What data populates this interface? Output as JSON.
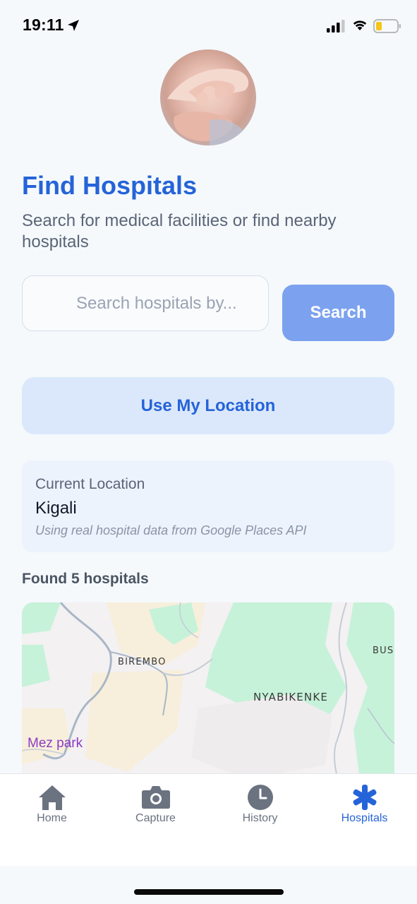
{
  "status_bar": {
    "time": "19:11",
    "icons": [
      "location-arrow-icon",
      "cellular-signal-icon",
      "wifi-icon",
      "battery-icon"
    ],
    "battery_color": "#f5c518"
  },
  "header": {
    "title": "Find Hospitals",
    "subtitle": "Search for medical facilities or find nearby hospitals"
  },
  "search": {
    "placeholder": "Search hospitals by...",
    "value": "",
    "button_label": "Search"
  },
  "location_button": {
    "label": "Use My Location"
  },
  "current_location": {
    "label": "Current Location",
    "city": "Kigali",
    "note": "Using real hospital data from Google Places API"
  },
  "results": {
    "found_text": "Found 5 hospitals"
  },
  "map": {
    "labels": {
      "birembo": "BIREMBO",
      "nyabikenke": "NYABIKENKE",
      "bus": "BUS",
      "mez_park": "Mez park"
    }
  },
  "tabs": [
    {
      "label": "Home",
      "icon": "home-icon",
      "active": false
    },
    {
      "label": "Capture",
      "icon": "camera-icon",
      "active": false
    },
    {
      "label": "History",
      "icon": "clock-icon",
      "active": false
    },
    {
      "label": "Hospitals",
      "icon": "asterisk-medical-icon",
      "active": true
    }
  ],
  "colors": {
    "accent": "#2563d8",
    "search_button": "#7ca2ef",
    "location_button_bg": "#dbe8fc",
    "map_green": "#c6f2d9",
    "map_beige": "#f7efdc"
  }
}
